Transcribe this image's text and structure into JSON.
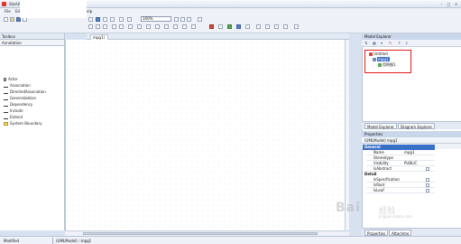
{
  "app": {
    "title": "StarUML"
  },
  "menu": [
    {
      "label": "File"
    },
    {
      "label": "Edit"
    },
    {
      "label": "Form"
    },
    {
      "label": "elp"
    }
  ],
  "toolbar": {
    "zoom_value": "100%"
  },
  "left_panel": {
    "toolbox_title": "Toolbox",
    "annotation_label": "Annotation",
    "items": [
      {
        "label": "Actor",
        "icon": "actor-icon"
      },
      {
        "label": "Association",
        "icon": "association-icon"
      },
      {
        "label": "DirectedAssociation",
        "icon": "directed-association-icon"
      },
      {
        "label": "Generalization",
        "icon": "generalization-icon"
      },
      {
        "label": "Dependency",
        "icon": "dependency-icon"
      },
      {
        "label": "Include",
        "icon": "include-icon"
      },
      {
        "label": "Extend",
        "icon": "extend-icon"
      },
      {
        "label": "System Boundary",
        "icon": "system-boundary-icon"
      }
    ]
  },
  "editor": {
    "tab_label": "mpg1)"
  },
  "model_explorer": {
    "title": "Model Explorer",
    "tree": [
      {
        "label": "Untitled",
        "level": 0
      },
      {
        "label": "mpg1",
        "level": 1,
        "selected": true
      },
      {
        "label": "用例图1",
        "level": 2
      }
    ],
    "tabs": [
      {
        "label": "Model Explorer"
      },
      {
        "label": "Diagram Explorer"
      }
    ]
  },
  "properties": {
    "title": "Properties",
    "subject": "(UMLModel) mpg1",
    "categories": [
      {
        "label": "General",
        "rows": [
          {
            "key": "Name",
            "value": "mpg1"
          },
          {
            "key": "Stereotype",
            "value": ""
          },
          {
            "key": "Visibility",
            "value": "PUBLIC"
          },
          {
            "key": "IsAbstract",
            "value": ""
          }
        ]
      },
      {
        "label": "Detail",
        "rows": [
          {
            "key": "IsSpecification",
            "value": ""
          },
          {
            "key": "IsRoot",
            "value": ""
          },
          {
            "key": "IsLeaf",
            "value": ""
          }
        ]
      }
    ],
    "bottom_tabs": [
      {
        "label": "Properties"
      },
      {
        "label": "Attachme"
      }
    ]
  },
  "status": {
    "mode": "Modified",
    "selection": "(UMLModel) ::mpg1"
  },
  "watermark": {
    "text": "Bai",
    "cn": "经验",
    "url": "jingyan.baidu.com"
  },
  "colors": {
    "selection": "#3a6fc8",
    "highlight_box": "#e21b1b",
    "panel_header": "#cad7ea"
  }
}
